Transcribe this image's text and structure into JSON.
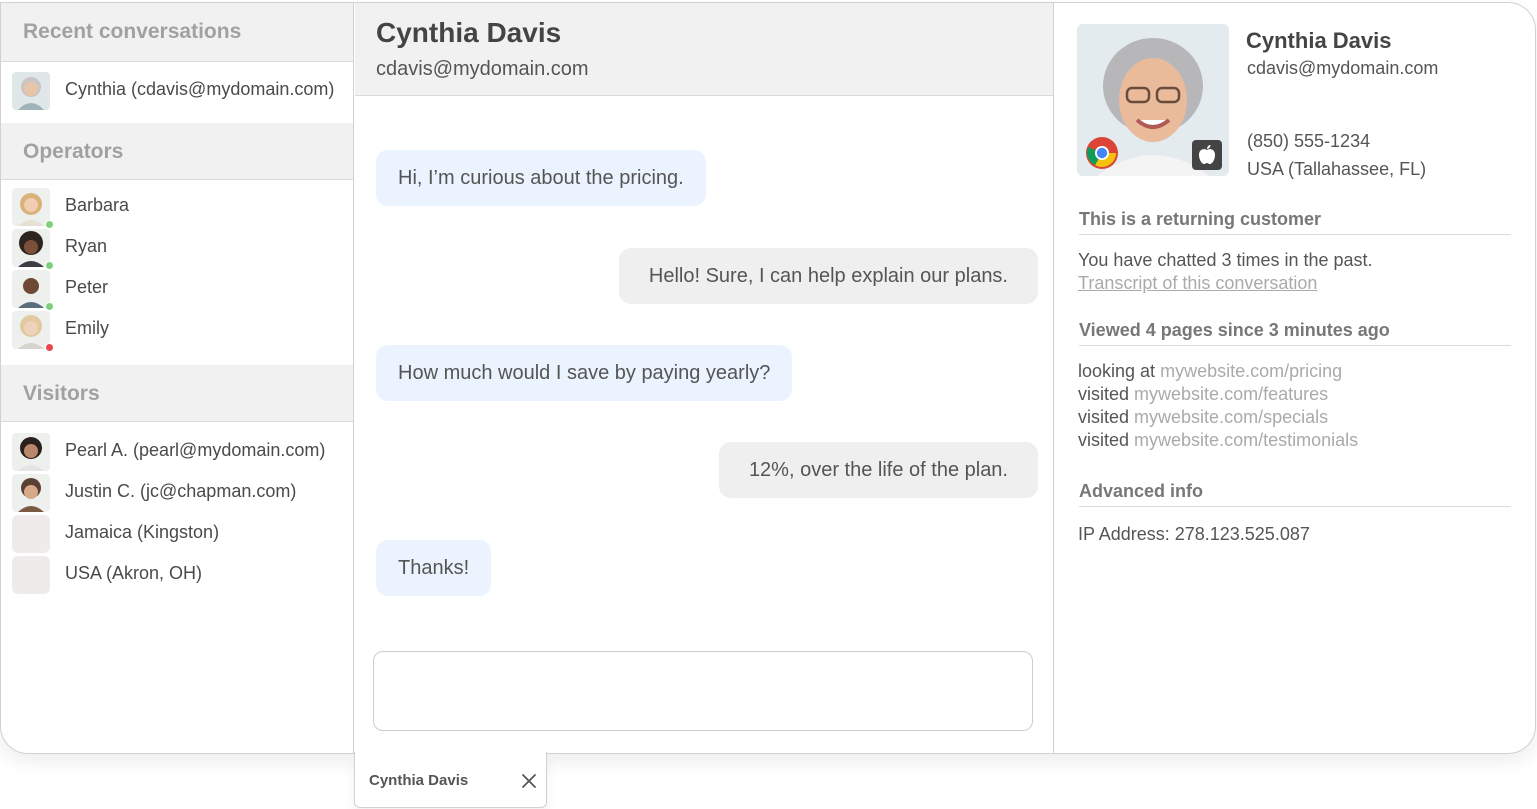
{
  "sidebar": {
    "recent_title": "Recent conversations",
    "recent": [
      {
        "label": "Cynthia (cdavis@mydomain.com)"
      }
    ],
    "operators_title": "Operators",
    "operators": [
      {
        "label": "Barbara",
        "status_color": "#7ed07a"
      },
      {
        "label": "Ryan",
        "status_color": "#7ed07a"
      },
      {
        "label": "Peter",
        "status_color": "#7ed07a"
      },
      {
        "label": "Emily",
        "status_color": "#e9474a"
      }
    ],
    "visitors_title": "Visitors",
    "visitors": [
      {
        "label": "Pearl A. (pearl@mydomain.com)"
      },
      {
        "label": "Justin C. (jc@chapman.com)"
      },
      {
        "label": "Jamaica (Kingston)"
      },
      {
        "label": "USA (Akron, OH)"
      }
    ]
  },
  "chat": {
    "name": "Cynthia Davis",
    "email": "cdavis@mydomain.com",
    "messages": [
      {
        "from": "visitor",
        "text": "Hi, I’m curious about the pricing."
      },
      {
        "from": "operator",
        "text": "Hello! Sure, I can help explain our plans."
      },
      {
        "from": "visitor",
        "text": "How much would I save by paying yearly?"
      },
      {
        "from": "operator",
        "text": "12%, over the life of the plan."
      },
      {
        "from": "visitor",
        "text": "Thanks!"
      }
    ],
    "composer_value": ""
  },
  "info": {
    "name": "Cynthia Davis",
    "email": "cdavis@mydomain.com",
    "phone": "(850) 555-1234",
    "location": "USA (Tallahassee, FL)",
    "browser_icon": "chrome-icon",
    "os_icon": "apple-icon",
    "returning_title": "This is a returning customer",
    "returning_text": "You have chatted 3 times in the past.",
    "transcript_link": "Transcript of this conversation",
    "pages_title": "Viewed 4 pages since 3 minutes ago",
    "pages": [
      {
        "verb": "looking at",
        "url": "mywebsite.com/pricing"
      },
      {
        "verb": "visited",
        "url": "mywebsite.com/features"
      },
      {
        "verb": "visited",
        "url": "mywebsite.com/specials"
      },
      {
        "verb": "visited",
        "url": "mywebsite.com/testimonials"
      }
    ],
    "advanced_title": "Advanced info",
    "ip_text": "IP Address: 278.123.525.087"
  },
  "tab": {
    "label": "Cynthia Davis",
    "close_icon": "close-icon"
  }
}
